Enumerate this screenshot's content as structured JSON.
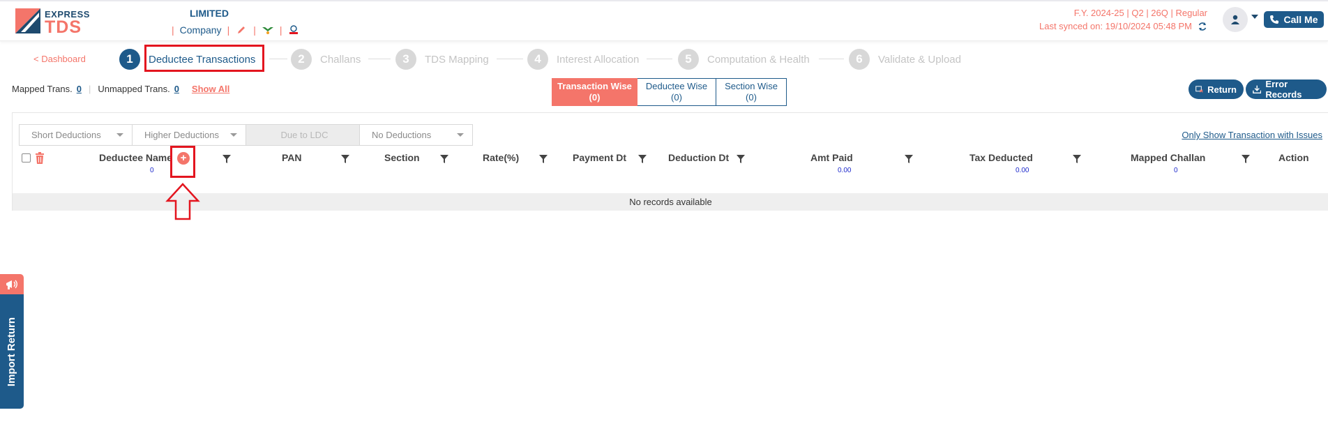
{
  "header": {
    "logo_express": "EXPRESS",
    "logo_tds": "TDS",
    "company_name": "LIMITED",
    "company_label": "Company",
    "fy_line": "F.Y. 2024-25  | Q2  | 26Q | Regular",
    "sync_line": "Last synced on: 19/10/2024 05:48 PM",
    "call_me": "Call Me"
  },
  "stepper": {
    "back_link": "< Dashboard",
    "steps": [
      {
        "num": "1",
        "label": "Deductee Transactions"
      },
      {
        "num": "2",
        "label": "Challans"
      },
      {
        "num": "3",
        "label": "TDS Mapping"
      },
      {
        "num": "4",
        "label": "Interest Allocation"
      },
      {
        "num": "5",
        "label": "Computation & Health"
      },
      {
        "num": "6",
        "label": "Validate & Upload"
      }
    ]
  },
  "summary": {
    "mapped_label": "Mapped Trans.",
    "mapped_count": "0",
    "unmapped_label": "Unmapped Trans.",
    "unmapped_count": "0",
    "show_all": "Show All"
  },
  "view_tabs": [
    {
      "label": "Transaction Wise",
      "count": "(0)"
    },
    {
      "label": "Deductee Wise",
      "count": "(0)"
    },
    {
      "label": "Section Wise",
      "count": "(0)"
    }
  ],
  "actions": {
    "return_label": "Return",
    "error_records_label": "Error Records"
  },
  "filters": {
    "short_deductions": "Short Deductions",
    "higher_deductions": "Higher Deductions",
    "due_to_ldc": "Due to LDC",
    "no_deductions": "No Deductions",
    "only_issues": "Only Show Transaction with Issues"
  },
  "table": {
    "columns": {
      "deductee_name": "Deductee Name",
      "deductee_count": "0",
      "pan": "PAN",
      "section": "Section",
      "rate": "Rate(%)",
      "payment_dt": "Payment Dt",
      "deduction_dt": "Deduction Dt",
      "amt_paid": "Amt Paid",
      "amt_paid_total": "0.00",
      "tax_deducted": "Tax Deducted",
      "tax_deducted_total": "0.00",
      "mapped_challan": "Mapped Challan",
      "mapped_challan_count": "0",
      "action": "Action"
    },
    "empty_message": "No records available"
  },
  "import_tab": {
    "label": "Import Return"
  },
  "colors": {
    "brand_blue": "#1e5a8a",
    "brand_coral": "#f4756a",
    "highlight_red": "#e3151f"
  }
}
